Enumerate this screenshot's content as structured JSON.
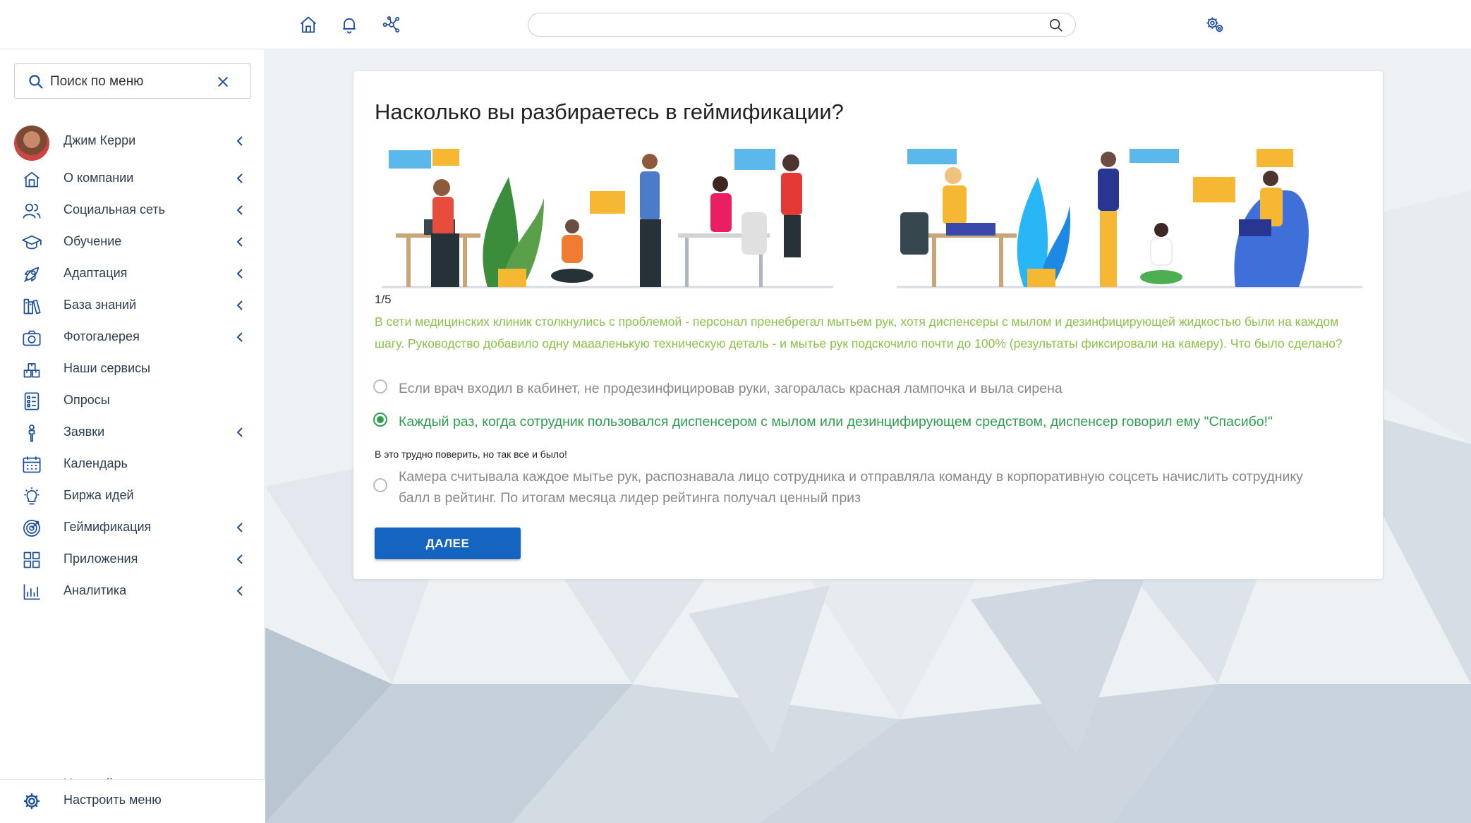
{
  "colors": {
    "accent": "#1565c0",
    "icon_blue": "#1e4f9c",
    "question_green": "#8bc34a",
    "selected_green": "#2e9e4f"
  },
  "topbar": {
    "icons": [
      "home-icon",
      "bell-icon",
      "network-icon",
      "settings-gears-icon"
    ],
    "search": {
      "value": "",
      "placeholder": ""
    }
  },
  "sidebar": {
    "menu_search": {
      "label": "Поиск по меню"
    },
    "user": {
      "name": "Джим Керри"
    },
    "items": [
      {
        "label": "О компании",
        "icon": "building-icon",
        "expandable": true
      },
      {
        "label": "Социальная сеть",
        "icon": "users-icon",
        "expandable": true
      },
      {
        "label": "Обучение",
        "icon": "graduation-cap-icon",
        "expandable": true
      },
      {
        "label": "Адаптация",
        "icon": "rocket-icon",
        "expandable": true
      },
      {
        "label": "База знаний",
        "icon": "books-icon",
        "expandable": true
      },
      {
        "label": "Фотогалерея",
        "icon": "camera-icon",
        "expandable": true
      },
      {
        "label": "Наши сервисы",
        "icon": "boxes-icon",
        "expandable": false
      },
      {
        "label": "Опросы",
        "icon": "survey-list-icon",
        "expandable": false
      },
      {
        "label": "Заявки",
        "icon": "request-icon",
        "expandable": true
      },
      {
        "label": "Календарь",
        "icon": "calendar-icon",
        "expandable": false
      },
      {
        "label": "Биржа идей",
        "icon": "lightbulb-icon",
        "expandable": false
      },
      {
        "label": "Геймификация",
        "icon": "target-icon",
        "expandable": true
      },
      {
        "label": "Приложения",
        "icon": "grid-apps-icon",
        "expandable": true
      },
      {
        "label": "Аналитика",
        "icon": "bar-chart-icon",
        "expandable": true
      }
    ],
    "partial_item": "Настройки компании",
    "configure": {
      "label": "Настроить меню"
    }
  },
  "quiz": {
    "title": "Насколько вы разбираетесь в геймификации?",
    "progress": "1/5",
    "question": "В сети медицинских клиник столкнулись с проблемой - персонал пренебрегал мытьем рук, хотя диспенсеры с мылом и дезинфицирующей жидкостью были на каждом шагу. Руководство добавило одну маааленькую техническую деталь - и мытье рук подскочило почти до 100% (результаты фиксировали на камеру). Что было сделано?",
    "options": [
      {
        "text": "Если врач входил в кабинет, не продезинфицировав руки, загоралась красная лампочка и выла сирена",
        "selected": false
      },
      {
        "text": "Каждый раз, когда сотрудник пользовался диспенсером с мылом или дезинцифирующем средством, диспенсер говорил ему \"Спасибо!\"",
        "selected": true
      },
      {
        "text": "Камера считывала каждое мытье рук, распознавала лицо сотрудника и отправляла команду в корпоративную соцсеть начислить сотруднику балл в рейтинг. По итогам месяца лидер рейтинга получал ценный приз",
        "selected": false
      }
    ],
    "feedback": "В это трудно поверить, но так все и было!",
    "next_label": "ДАЛЕЕ"
  }
}
